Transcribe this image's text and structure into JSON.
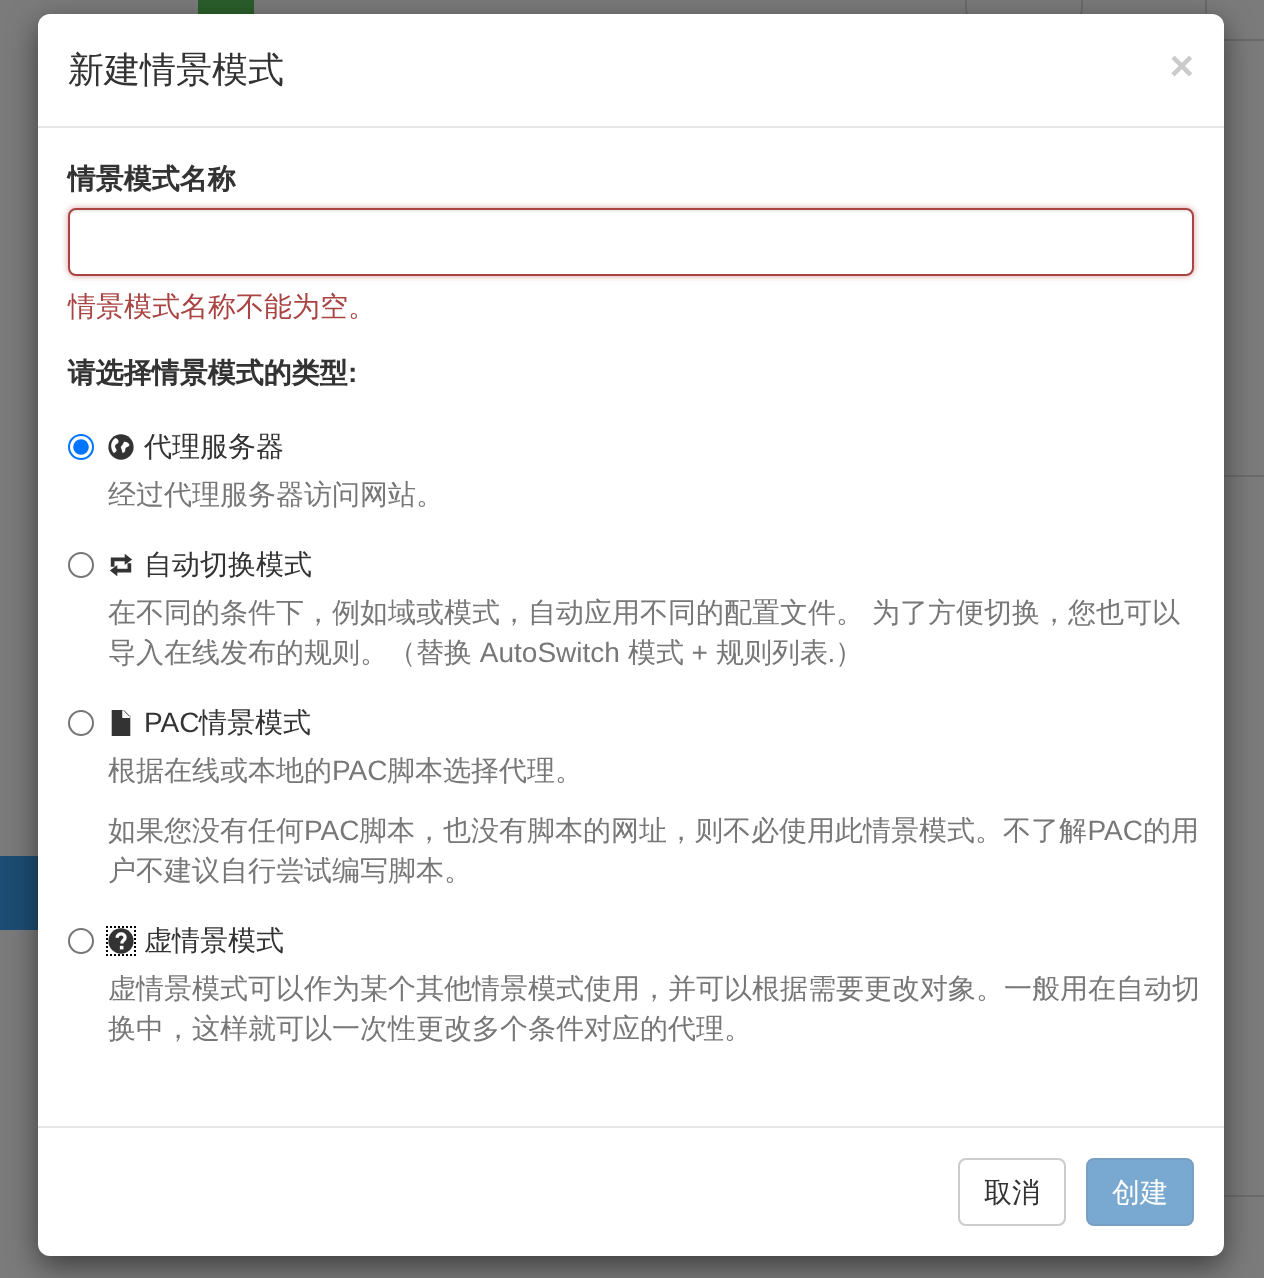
{
  "dialog": {
    "title": "新建情景模式",
    "close": "×"
  },
  "name_field": {
    "label": "情景模式名称",
    "invalid": true,
    "error": "情景模式名称不能为空。"
  },
  "type_prompt": "请选择情景模式的类型:",
  "types": [
    {
      "kind": "proxy",
      "label": "代理服务器",
      "selected": true,
      "focused": false,
      "descriptions": [
        "经过代理服务器访问网站。"
      ]
    },
    {
      "kind": "switch",
      "label": "自动切换模式",
      "selected": false,
      "focused": false,
      "descriptions": [
        "在不同的条件下，例如域或模式，自动应用不同的配置文件。 为了方便切换，您也可以导入在线发布的规则。（替换 AutoSwitch 模式 + 规则列表.）"
      ]
    },
    {
      "kind": "pac",
      "label": "PAC情景模式",
      "selected": false,
      "focused": false,
      "descriptions": [
        "根据在线或本地的PAC脚本选择代理。",
        "如果您没有任何PAC脚本，也没有脚本的网址，则不必使用此情景模式。不了解PAC的用户不建议自行尝试编写脚本。"
      ]
    },
    {
      "kind": "virtual",
      "label": "虚情景模式",
      "selected": false,
      "focused": true,
      "descriptions": [
        "虚情景模式可以作为某个其他情景模式使用，并可以根据需要更改对象。一般用在自动切换中，这样就可以一次性更改多个条件对应的代理。"
      ]
    }
  ],
  "buttons": [
    {
      "kind": "default",
      "label": "取消",
      "disabled": false
    },
    {
      "kind": "primary",
      "label": "创建",
      "disabled": true
    }
  ]
}
